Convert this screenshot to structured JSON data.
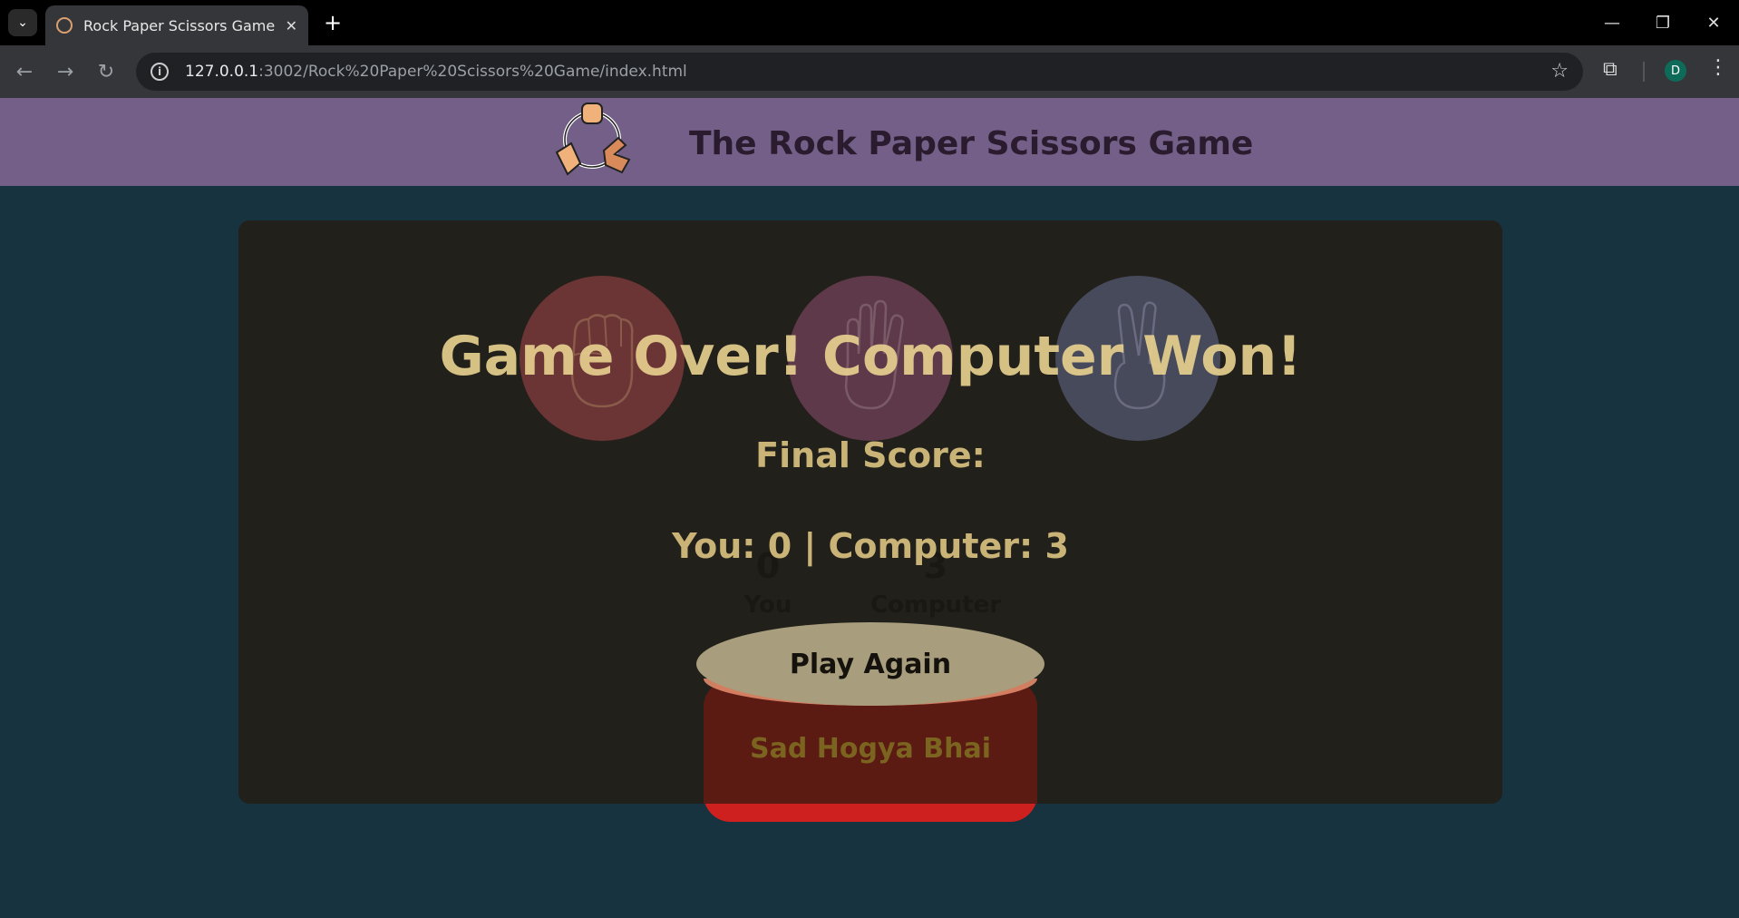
{
  "browser": {
    "tab_title": "Rock Paper Scissors Game",
    "url_host": "127.0.0.1",
    "url_path": ":3002/Rock%20Paper%20Scissors%20Game/index.html",
    "avatar_letter": "D"
  },
  "header": {
    "title": "The Rock Paper Scissors Game"
  },
  "choices": [
    {
      "name": "rock",
      "color": "#6b3535"
    },
    {
      "name": "paper",
      "color": "#5e394a"
    },
    {
      "name": "scissors",
      "color": "#474a5b"
    }
  ],
  "scoreboard": {
    "user_score": "0",
    "user_label": "You",
    "comp_score": "3",
    "comp_label": "Computer"
  },
  "message": {
    "text": "Sad Hogya Bhai",
    "color": "#cf2020"
  },
  "gameover": {
    "title": "Game Over! Computer Won!",
    "final_label": "Final Score:",
    "final_score": "You: 0 | Computer: 3",
    "play_again": "Play Again"
  }
}
